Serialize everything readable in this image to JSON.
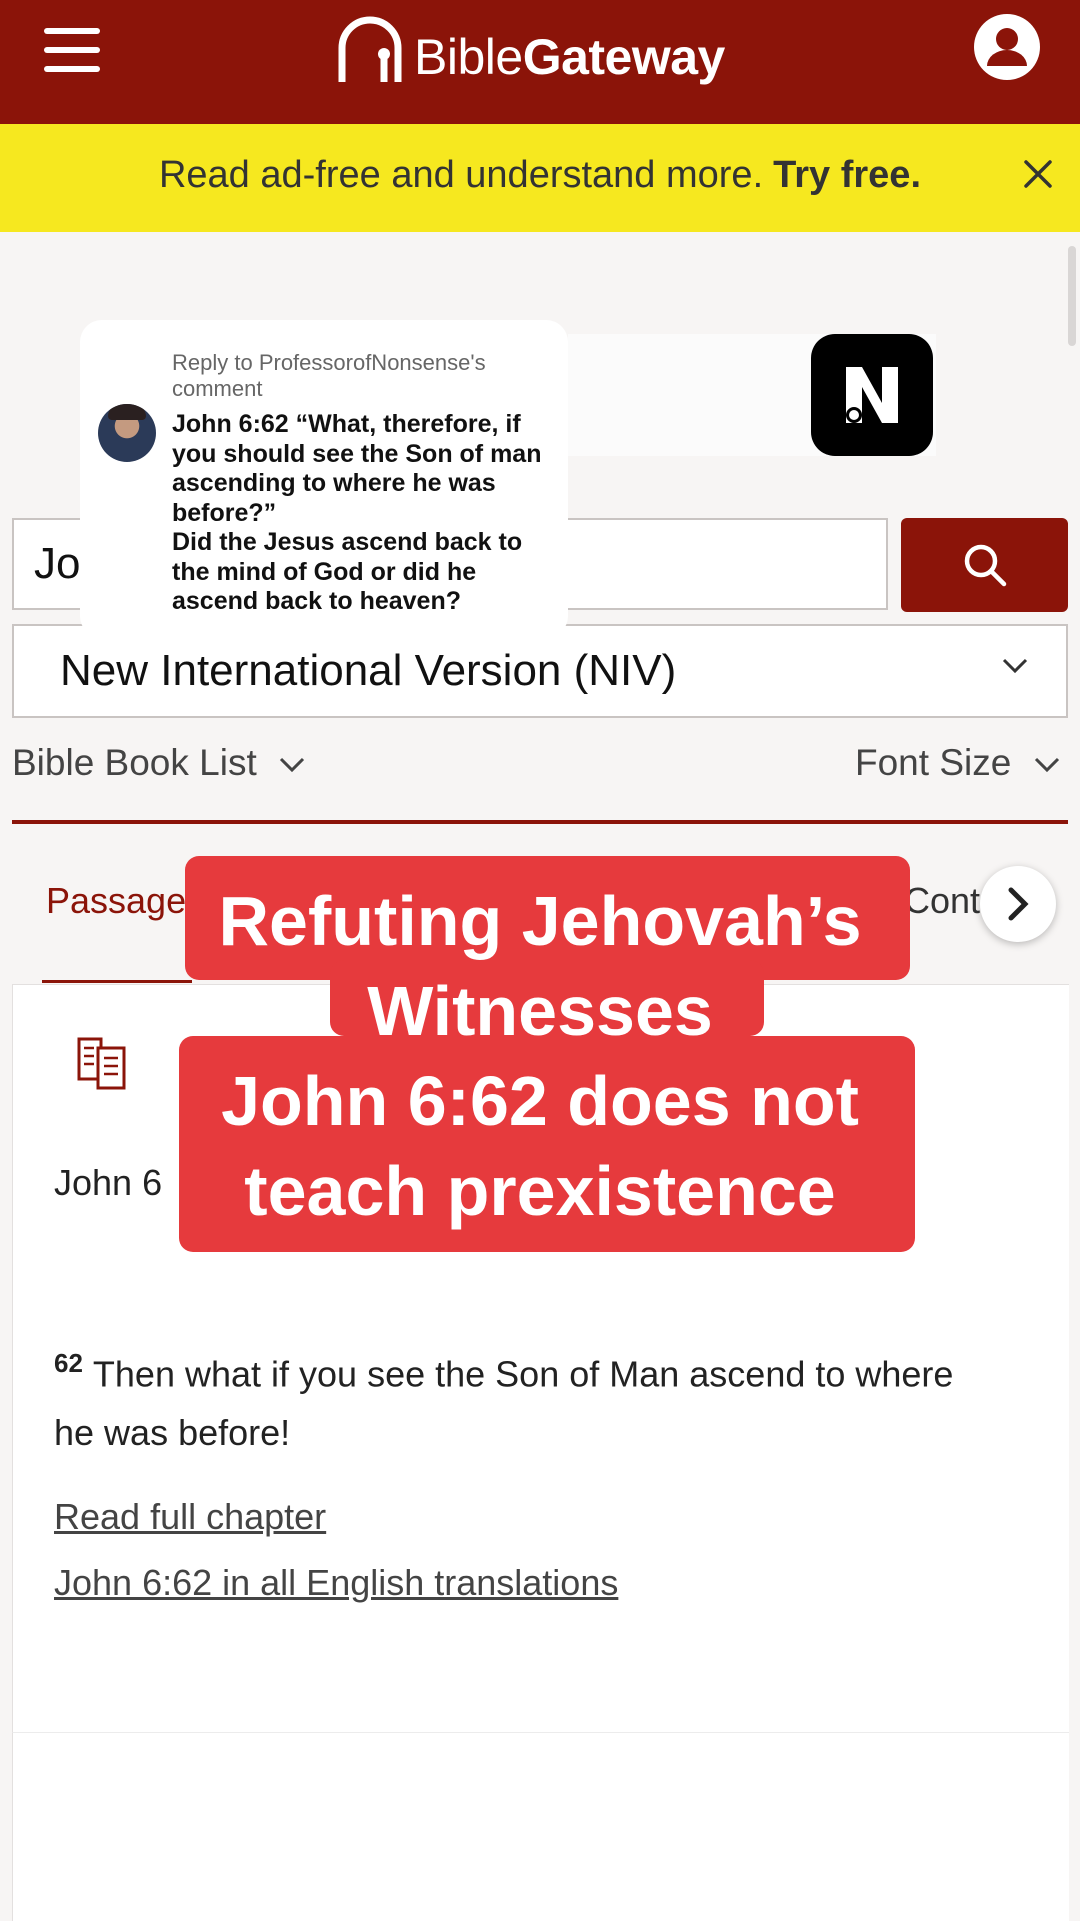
{
  "header": {
    "logo_light": "Bible",
    "logo_bold": "Gateway"
  },
  "promo": {
    "lead": "Read ad-free and understand more.",
    "cta": "Try free."
  },
  "comment": {
    "reply_to": "Reply to ProfessorofNonsense's comment",
    "body": "John 6:62 “What, therefore, if you should see the Son of man ascending to where he was before?”\nDid the Jesus ascend back to the mind of God or did he ascend back to heaven?"
  },
  "search": {
    "value": "Jo"
  },
  "version": {
    "selected": "New International Version (NIV)"
  },
  "toolbar": {
    "book_list": "Bible Book List",
    "font_size": "Font Size"
  },
  "tabs": {
    "passage": "Passage",
    "cont": "Cont"
  },
  "passage": {
    "reference": "John 6",
    "verse_number": "62",
    "verse_text": "Then what if you see the Son of Man ascend to where he was before!",
    "read_full_chapter": "Read full chapter",
    "all_translations": "John 6:62 in all English translations"
  },
  "caption": {
    "line1": "Refuting Jehovah’s",
    "line2": "Witnesses",
    "line3": "John 6:62 does not",
    "line4": "teach prexistence"
  },
  "colors": {
    "header": "#8b1409",
    "promo": "#f6e81f",
    "caption": "#e63a3d",
    "accent": "#8b1409"
  },
  "icons": {
    "menu": "hamburger-menu-icon",
    "logo": "biblegateway-logo-icon",
    "account": "user-account-icon",
    "close": "close-icon",
    "search": "search-icon",
    "dropdown": "chevron-down-icon",
    "next": "chevron-right-icon",
    "parallel": "parallel-view-icon",
    "app": "app-badge-icon"
  }
}
